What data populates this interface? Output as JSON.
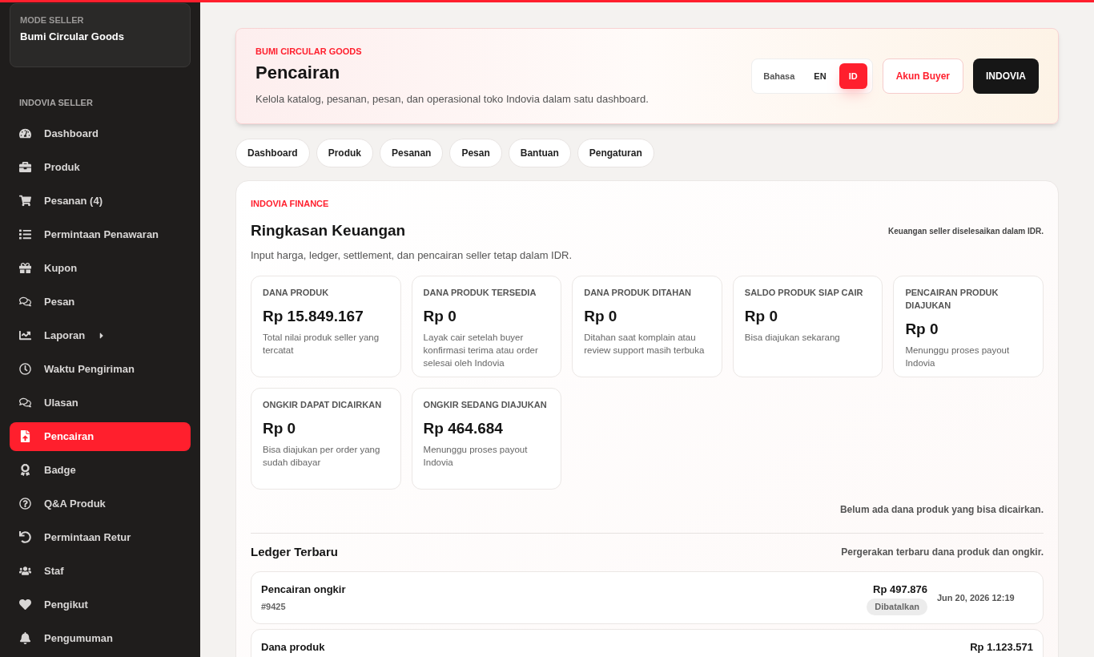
{
  "sidebar": {
    "mode_label": "MODE SELLER",
    "store_name": "Bumi Circular Goods",
    "section_label": "INDOVIA SELLER",
    "items": [
      {
        "label": "Dashboard",
        "selected": false
      },
      {
        "label": "Produk",
        "selected": false
      },
      {
        "label": "Pesanan (4)",
        "selected": false
      },
      {
        "label": "Permintaan Penawaran",
        "selected": false
      },
      {
        "label": "Kupon",
        "selected": false
      },
      {
        "label": "Pesan",
        "selected": false
      },
      {
        "label": "Laporan",
        "selected": false,
        "expanded": false
      },
      {
        "label": "Waktu Pengiriman",
        "selected": false
      },
      {
        "label": "Ulasan",
        "selected": false
      },
      {
        "label": "Pencairan",
        "selected": true
      },
      {
        "label": "Badge",
        "selected": false
      },
      {
        "label": "Q&A Produk",
        "selected": false
      },
      {
        "label": "Permintaan Retur",
        "selected": false
      },
      {
        "label": "Staf",
        "selected": false
      },
      {
        "label": "Pengikut",
        "selected": false
      },
      {
        "label": "Pengumuman",
        "selected": false
      }
    ]
  },
  "header": {
    "eyebrow": "BUMI CIRCULAR GOODS",
    "title": "Pencairan",
    "subtitle": "Kelola katalog, pesanan, pesan, dan operasional toko Indovia dalam satu dashboard.",
    "language": {
      "label": "Bahasa",
      "options": [
        {
          "label": "EN",
          "selected": false
        },
        {
          "label": "ID",
          "selected": true
        }
      ]
    },
    "buyer_button": "Akun Buyer",
    "brand_button": "INDOVIA"
  },
  "nav_pills": [
    "Dashboard",
    "Produk",
    "Pesanan",
    "Pesan",
    "Bantuan",
    "Pengaturan"
  ],
  "finance": {
    "eyebrow": "INDOVIA FINANCE",
    "title": "Ringkasan Keuangan",
    "note": "Keuangan seller diselesaikan dalam IDR.",
    "subtitle": "Input harga, ledger, settlement, dan pencairan seller tetap dalam IDR.",
    "cards": [
      {
        "label": "DANA PRODUK",
        "value": "Rp 15.849.167",
        "description": "Total nilai produk seller yang tercatat"
      },
      {
        "label": "DANA PRODUK TERSEDIA",
        "value": "Rp 0",
        "description": "Layak cair setelah buyer konfirmasi terima atau order selesai oleh Indovia"
      },
      {
        "label": "DANA PRODUK DITAHAN",
        "value": "Rp 0",
        "description": "Ditahan saat komplain atau review support masih terbuka"
      },
      {
        "label": "SALDO PRODUK SIAP CAIR",
        "value": "Rp 0",
        "description": "Bisa diajukan sekarang"
      },
      {
        "label": "PENCAIRAN PRODUK DIAJUKAN",
        "value": "Rp 0",
        "description": "Menunggu proses payout Indovia"
      },
      {
        "label": "ONGKIR DAPAT DICAIRKAN",
        "value": "Rp 0",
        "description": "Bisa diajukan per order yang sudah dibayar"
      },
      {
        "label": "ONGKIR SEDANG DIAJUKAN",
        "value": "Rp 464.684",
        "description": "Menunggu proses payout Indovia"
      }
    ],
    "empty_note": "Belum ada dana produk yang bisa dicairkan."
  },
  "ledger": {
    "title": "Ledger Terbaru",
    "note": "Pergerakan terbaru dana produk dan ongkir.",
    "rows": [
      {
        "title": "Pencairan ongkir",
        "reference": "#9425",
        "amount": "Rp 497.876",
        "status": "Dibatalkan",
        "date": "Jun 20, 2026 12:19"
      },
      {
        "title": "Dana produk",
        "amount": "Rp 1.123.571"
      }
    ]
  }
}
